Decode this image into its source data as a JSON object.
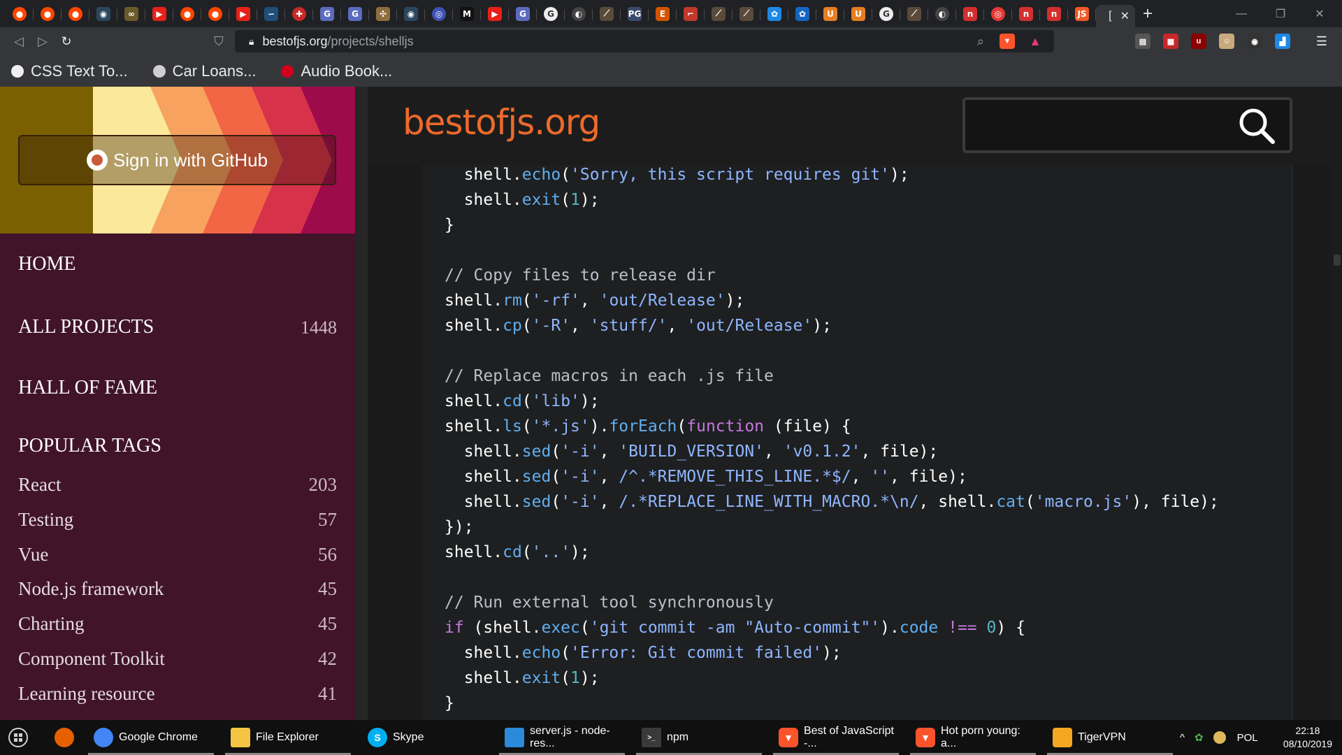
{
  "browser": {
    "active_tab_label": "[",
    "new_tab_icon": "plus-icon",
    "url_domain": "bestofjs.org",
    "url_path": "/projects/shelljs",
    "bookmarks": [
      {
        "label": "CSS Text To...",
        "color": "#f0f0f0"
      },
      {
        "label": "Car Loans...",
        "color": "#cfcfcf"
      },
      {
        "label": "Audio Book...",
        "color": "#d0021b"
      }
    ]
  },
  "sidebar": {
    "signin_label": "Sign in with GitHub",
    "home": "HOME",
    "all_projects": "ALL PROJECTS",
    "all_projects_count": "1448",
    "hall_of_fame": "HALL OF FAME",
    "popular_tags": "POPULAR TAGS",
    "tags": [
      {
        "name": "React",
        "count": "203"
      },
      {
        "name": "Testing",
        "count": "57"
      },
      {
        "name": "Vue",
        "count": "56"
      },
      {
        "name": "Node.js framework",
        "count": "45"
      },
      {
        "name": "Charting",
        "count": "45"
      },
      {
        "name": "Component Toolkit",
        "count": "42"
      },
      {
        "name": "Learning resource",
        "count": "41"
      }
    ]
  },
  "header": {
    "logo": "bestofjs.org",
    "search_value": ""
  },
  "code": {
    "lines": [
      "  shell.echo('Sorry, this script requires git');",
      "  shell.exit(1);",
      "}",
      "",
      "// Copy files to release dir",
      "shell.rm('-rf', 'out/Release');",
      "shell.cp('-R', 'stuff/', 'out/Release');",
      "",
      "// Replace macros in each .js file",
      "shell.cd('lib');",
      "shell.ls('*.js').forEach(function (file) {",
      "  shell.sed('-i', 'BUILD_VERSION', 'v0.1.2', file);",
      "  shell.sed('-i', /^.*REMOVE_THIS_LINE.*$/, '', file);",
      "  shell.sed('-i', /.*REPLACE_LINE_WITH_MACRO.*\\n/, shell.cat('macro.js'), file);",
      "});",
      "shell.cd('..');",
      "",
      "// Run external tool synchronously",
      "if (shell.exec('git commit -am \"Auto-commit\"').code !== 0) {",
      "  shell.echo('Error: Git commit failed');",
      "  shell.exit(1);",
      "}"
    ]
  },
  "taskbar": {
    "items": [
      {
        "label": "Google Chrome",
        "icon": "chrome-icon",
        "color": "#4285f4"
      },
      {
        "label": "File Explorer",
        "icon": "folder-icon",
        "color": "#f4c542"
      },
      {
        "label": "Skype",
        "icon": "skype-icon",
        "color": "#00aff0"
      },
      {
        "label": "server.js - node-res...",
        "icon": "vscode-icon",
        "color": "#2b8ad9"
      },
      {
        "label": "npm",
        "icon": "terminal-icon",
        "color": "#3a3a3a"
      },
      {
        "label": "Best of JavaScript -...",
        "icon": "brave-icon",
        "color": "#fb542b"
      },
      {
        "label": "Hot porn young: a...",
        "icon": "brave-icon",
        "color": "#fb542b"
      },
      {
        "label": "TigerVPN",
        "icon": "tiger-icon",
        "color": "#f5a623"
      }
    ],
    "language": "POL",
    "time": "22:18",
    "date": "08/10/2019"
  }
}
